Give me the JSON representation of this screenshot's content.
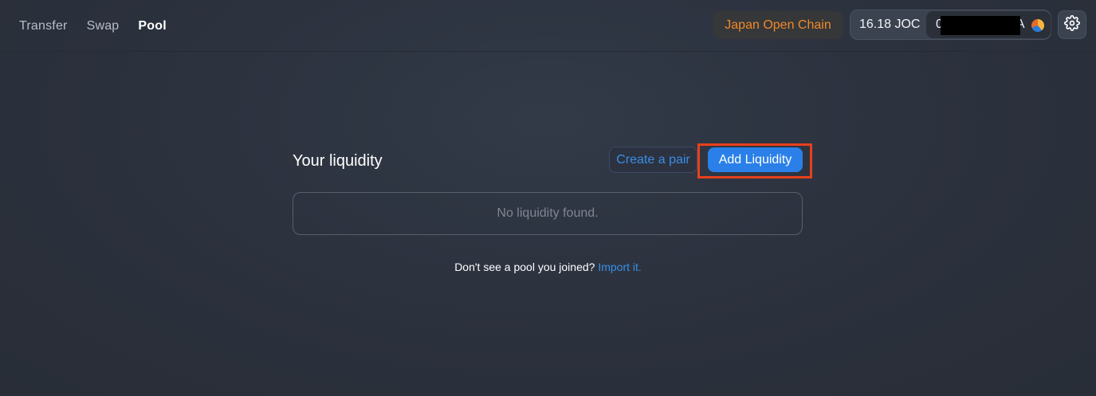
{
  "nav": {
    "items": [
      {
        "label": "Transfer"
      },
      {
        "label": "Swap"
      },
      {
        "label": "Pool"
      }
    ]
  },
  "header": {
    "network": "Japan Open Chain",
    "balance": "16.18 JOC",
    "account_prefix": "0",
    "account_suffix": "A",
    "settings_icon": "gear-icon"
  },
  "main": {
    "title": "Your liquidity",
    "create_pair_label": "Create a pair",
    "add_liquidity_label": "Add Liquidity",
    "empty_message": "No liquidity found.",
    "import_prompt": "Don't see a pool you joined?",
    "import_link": "Import it."
  },
  "colors": {
    "accent": "#2a80e8",
    "network_text": "#f08a2c",
    "highlight": "#e8401c"
  }
}
